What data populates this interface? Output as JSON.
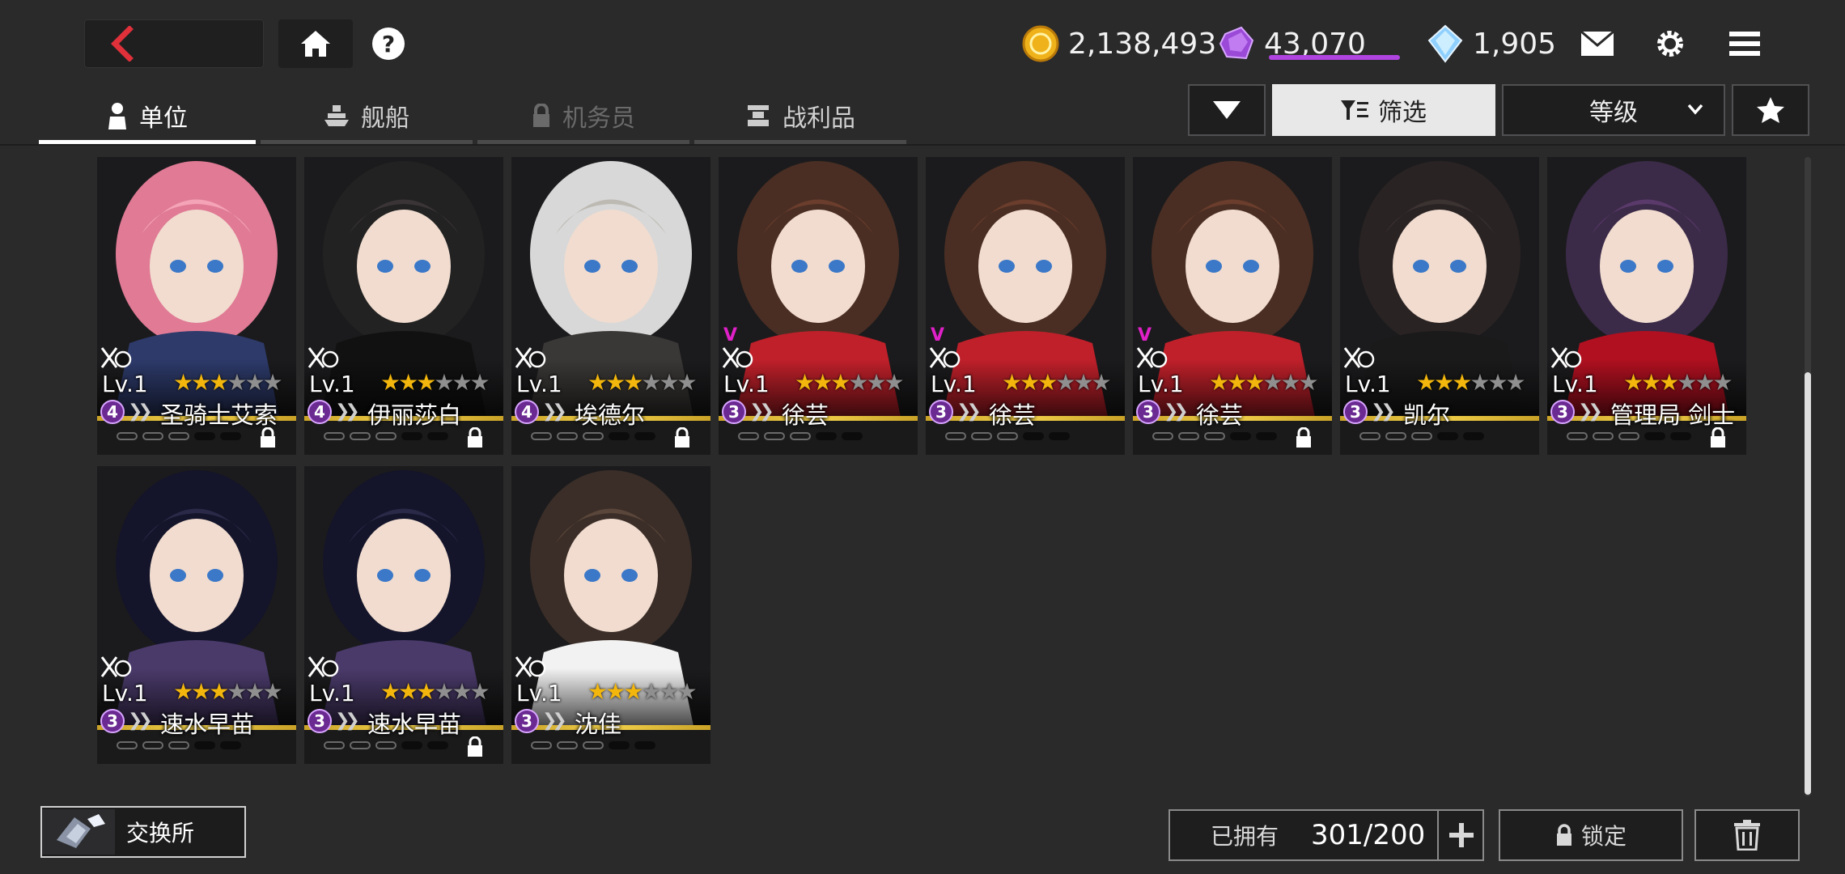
{
  "currencies": [
    {
      "name": "gold-coin",
      "value": "2,138,493",
      "color": "#f0b21a"
    },
    {
      "name": "purple-gem",
      "value": "43,070",
      "color": "#9b4ad8"
    },
    {
      "name": "blue-crystal",
      "value": "1,905",
      "color": "#8fd0ff"
    }
  ],
  "tabs": [
    {
      "label": "单位",
      "icon": "person-icon",
      "active": true
    },
    {
      "label": "舰船",
      "icon": "ship-icon",
      "active": false
    },
    {
      "label": "机务员",
      "icon": "lock-icon",
      "locked": true
    },
    {
      "label": "战利品",
      "icon": "trophy-icon",
      "active": false
    }
  ],
  "toolbar": {
    "filter_label": "筛选",
    "sort_label": "等级"
  },
  "units": [
    {
      "level": "Lv.1",
      "stars": 3,
      "max_stars": 6,
      "rank": "4",
      "name": "圣骑士艾索",
      "locked": true
    },
    {
      "level": "Lv.1",
      "stars": 3,
      "max_stars": 6,
      "rank": "4",
      "name": "伊丽莎白",
      "locked": true
    },
    {
      "level": "Lv.1",
      "stars": 3,
      "max_stars": 6,
      "rank": "4",
      "name": "埃德尔",
      "locked": true
    },
    {
      "level": "Lv.1",
      "stars": 3,
      "max_stars": 6,
      "rank": "3",
      "name": "徐芸",
      "locked": false
    },
    {
      "level": "Lv.1",
      "stars": 3,
      "max_stars": 6,
      "rank": "3",
      "name": "徐芸",
      "locked": false
    },
    {
      "level": "Lv.1",
      "stars": 3,
      "max_stars": 6,
      "rank": "3",
      "name": "徐芸",
      "locked": true
    },
    {
      "level": "Lv.1",
      "stars": 3,
      "max_stars": 6,
      "rank": "3",
      "name": "凯尔",
      "locked": false
    },
    {
      "level": "Lv.1",
      "stars": 3,
      "max_stars": 6,
      "rank": "3",
      "name": "管理局 剑士",
      "locked": true
    },
    {
      "level": "Lv.1",
      "stars": 3,
      "max_stars": 6,
      "rank": "3",
      "name": "速水早苗",
      "locked": false
    },
    {
      "level": "Lv.1",
      "stars": 3,
      "max_stars": 6,
      "rank": "3",
      "name": "速水早苗",
      "locked": true
    },
    {
      "level": "Lv.1",
      "stars": 3,
      "max_stars": 6,
      "rank": "3",
      "name": "沈佳",
      "locked": false
    }
  ],
  "bottom": {
    "exchange_label": "交换所",
    "owned_label": "已拥有",
    "owned_count": "301/200",
    "lock_label": "锁定"
  }
}
